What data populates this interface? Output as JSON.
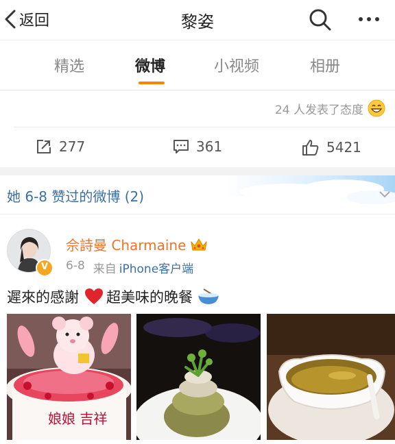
{
  "nav": {
    "back_label": "返回",
    "title": "黎姿"
  },
  "tabs": [
    {
      "label": "精选"
    },
    {
      "label": "微博"
    },
    {
      "label": "小视频"
    },
    {
      "label": "相册"
    }
  ],
  "reactions": {
    "summary": "24 人发表了态度"
  },
  "actions": {
    "repost_count": "277",
    "comment_count": "361",
    "like_count": "5421"
  },
  "liked_header": {
    "text": "她 6-8 赞过的微博 (2)"
  },
  "post": {
    "author": "佘詩曼 Charmaine",
    "date": "6-8",
    "from_label": "来自",
    "source": "iPhone客户端",
    "text_part1": "遲來的感謝",
    "text_part2": "超美味的晚餐",
    "cake_text": "娘娘 吉祥"
  },
  "colors": {
    "accent": "#ff8200",
    "link": "#3a6fa5",
    "author": "#f17324",
    "gray": "#999999"
  }
}
